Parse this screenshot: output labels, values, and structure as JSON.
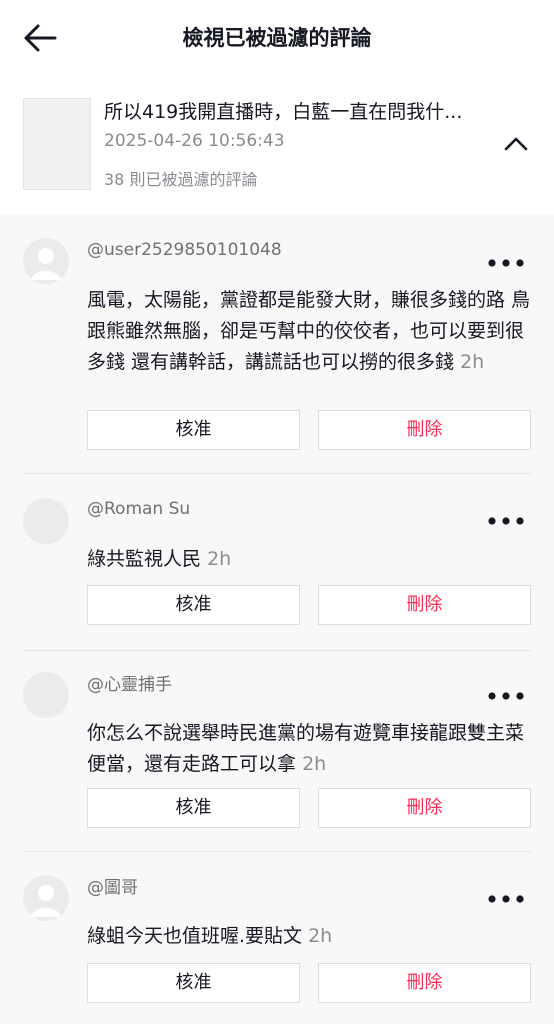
{
  "header": {
    "title": "檢視已被過濾的評論",
    "back_icon": "arrow-left-icon"
  },
  "video": {
    "title": "所以419我開直播時，白藍一直在問我什...",
    "date": "2025-04-26 10:56:43",
    "filtered_count": "38 則已被過濾的評論",
    "collapse_icon": "chevron-up-icon"
  },
  "comments": [
    {
      "username": "@user2529850101048",
      "text": "風電，太陽能，黨證都是能發大財，賺很多錢的路 鳥跟熊雖然無腦，卻是丐幫中的佼佼者，也可以要到很多錢 還有講幹話，講謊話也可以撈的很多錢",
      "time": "2h",
      "approve": "核准",
      "delete": "刪除"
    },
    {
      "username": "@Roman Su",
      "text": "綠共監視人民",
      "time": "2h",
      "approve": "核准",
      "delete": "刪除"
    },
    {
      "username": "@心靈捕手",
      "text": "你怎么不說選舉時民進黨的場有遊覽車接龍跟雙主菜便當，還有走路工可以拿",
      "time": "2h",
      "approve": "核准",
      "delete": "刪除"
    },
    {
      "username": "@圖哥",
      "text": "綠蛆今天也值班喔.要貼文",
      "time": "2h",
      "approve": "核准",
      "delete": "刪除"
    }
  ],
  "colors": {
    "delete_text": "#fe2c55",
    "secondary_text": "#8a8b91",
    "background": "#f8f8f8"
  }
}
